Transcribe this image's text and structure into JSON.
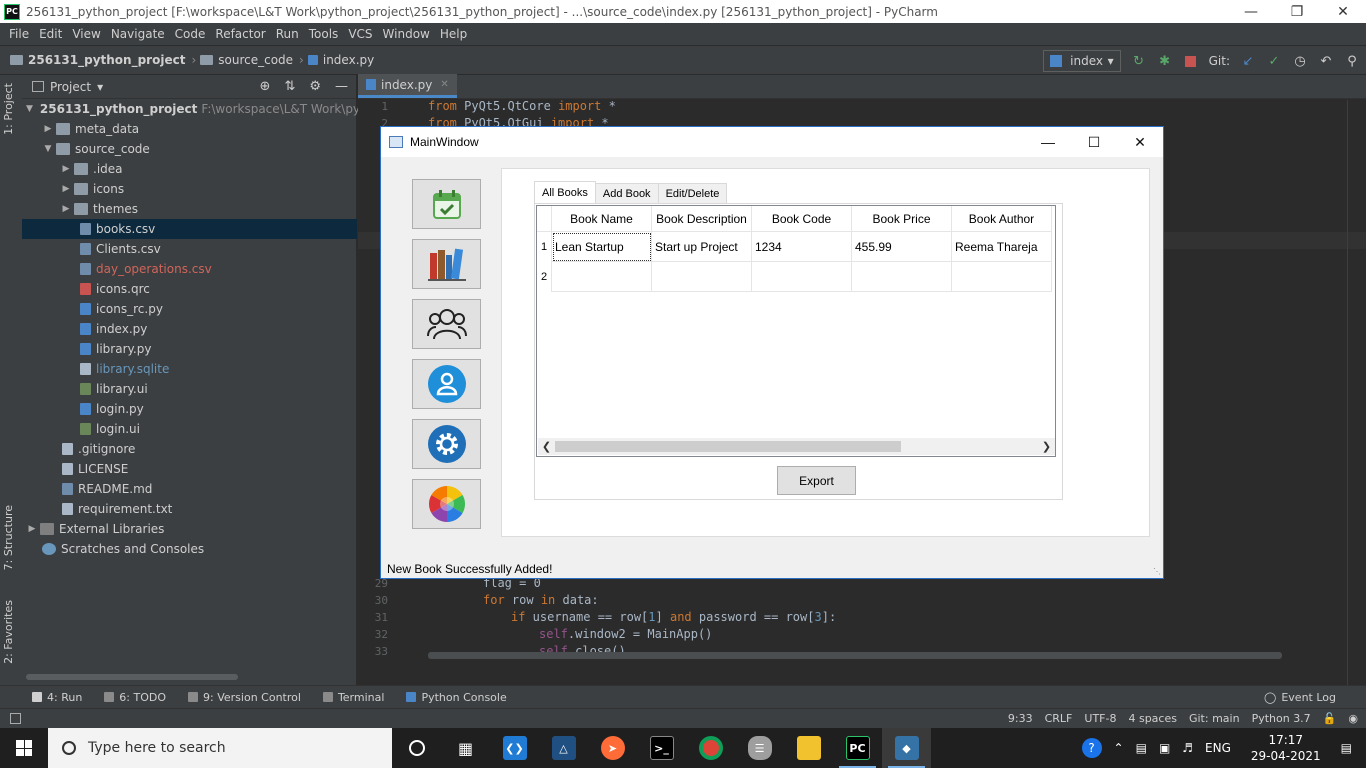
{
  "window": {
    "title": "256131_python_project [F:\\workspace\\L&T Work\\python_project\\256131_python_project] - ...\\source_code\\index.py [256131_python_project] - PyCharm",
    "logo": "PC"
  },
  "menu": [
    "File",
    "Edit",
    "View",
    "Navigate",
    "Code",
    "Refactor",
    "Run",
    "Tools",
    "VCS",
    "Window",
    "Help"
  ],
  "navbar": {
    "project": "256131_python_project",
    "folder": "source_code",
    "file": "index.py",
    "run_config": "index",
    "git_label": "Git:"
  },
  "side_tools": {
    "project": "1: Project",
    "structure": "7: Structure",
    "favorites": "2: Favorites"
  },
  "project_panel": {
    "header": "Project",
    "root_name": "256131_python_project",
    "root_path": "F:\\workspace\\L&T Work\\pytho",
    "items": [
      {
        "label": "meta_data"
      },
      {
        "label": "source_code"
      },
      {
        "label": ".idea"
      },
      {
        "label": "icons"
      },
      {
        "label": "themes"
      },
      {
        "label": "books.csv"
      },
      {
        "label": "Clients.csv"
      },
      {
        "label": "day_operations.csv"
      },
      {
        "label": "icons.qrc"
      },
      {
        "label": "icons_rc.py"
      },
      {
        "label": "index.py"
      },
      {
        "label": "library.py"
      },
      {
        "label": "library.sqlite"
      },
      {
        "label": "library.ui"
      },
      {
        "label": "login.py"
      },
      {
        "label": "login.ui"
      },
      {
        "label": ".gitignore"
      },
      {
        "label": "LICENSE"
      },
      {
        "label": "README.md"
      },
      {
        "label": "requirement.txt"
      },
      {
        "label": "External Libraries"
      },
      {
        "label": "Scratches and Consoles"
      }
    ]
  },
  "editor": {
    "tab": "index.py",
    "lines": {
      "l1": "1",
      "l2": "2",
      "l29": "29",
      "l30": "30",
      "l31": "31",
      "l32": "32",
      "l33": "33"
    },
    "code": {
      "c1_kw1": "from",
      "c1_mod": " PyQt5.QtCore ",
      "c1_kw2": "import",
      "c1_rest": " *",
      "c2_kw1": "from",
      "c2_mod": " PyQt5.QtGui ",
      "c2_kw2": "import",
      "c2_rest": " *",
      "c29": "flag = 0",
      "c30_kw1": "for",
      "c30_a": " row ",
      "c30_kw2": "in",
      "c30_b": " data:",
      "c31_kw1": "if",
      "c31_a": " username == row[",
      "c31_n1": "1",
      "c31_b": "] ",
      "c31_kw2": "and",
      "c31_c": " password == row[",
      "c31_n2": "3",
      "c31_d": "]:",
      "c32_self": "self",
      "c32_rest": ".window2 = MainApp()",
      "c33_self": "self",
      "c33_rest": ".close()"
    }
  },
  "bottom_tools": {
    "run": "4: Run",
    "todo": "6: TODO",
    "vcs": "9: Version Control",
    "terminal": "Terminal",
    "console": "Python Console",
    "event_log": "Event Log"
  },
  "statusbar": {
    "position": "9:33",
    "line_sep": "CRLF",
    "encoding": "UTF-8",
    "indent": "4 spaces",
    "git": "Git: main",
    "interpreter": "Python 3.7"
  },
  "taskbar": {
    "search_placeholder": "Type here to search",
    "lang": "ENG",
    "time": "17:17",
    "date": "29-04-2021"
  },
  "app": {
    "title": "MainWindow",
    "tabs": [
      "All Books",
      "Add Book",
      "Edit/Delete"
    ],
    "table": {
      "headers": [
        "Book Name",
        "Book Description",
        "Book Code",
        "Book Price",
        "Book Author"
      ],
      "row_numbers": [
        "1",
        "2"
      ],
      "rows": [
        [
          "Lean Startup",
          "Start up Project",
          "1234",
          "455.99",
          "Reema Thareja"
        ],
        [
          "",
          "",
          "",
          "",
          ""
        ]
      ]
    },
    "export_label": "Export",
    "status_message": "New Book Successfully Added!",
    "side_buttons": [
      "calendar-icon",
      "books-icon",
      "users-icon",
      "user-icon",
      "settings-icon",
      "color-wheel-icon"
    ]
  }
}
